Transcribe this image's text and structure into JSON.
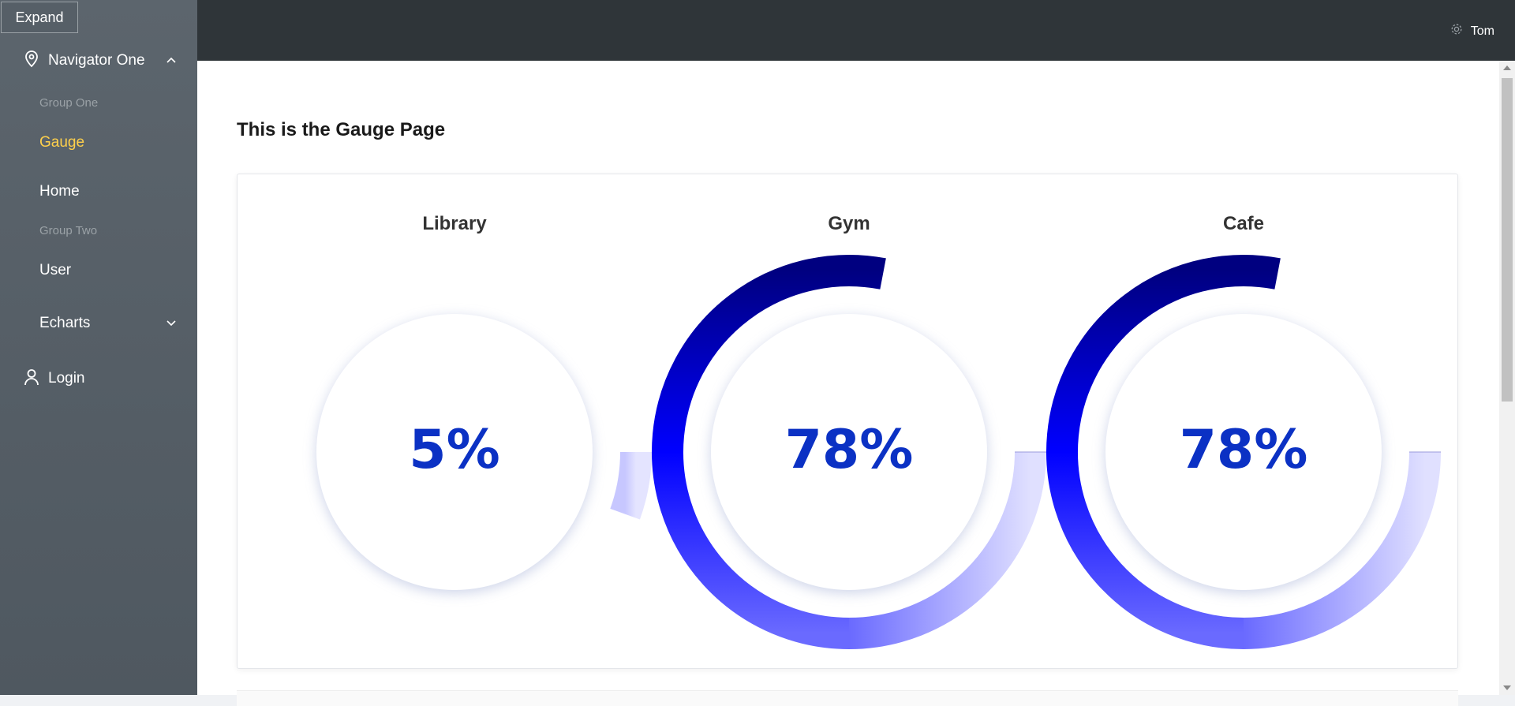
{
  "sidebar": {
    "expand_label": "Expand",
    "navigator_one": "Navigator One",
    "group_one": "Group One",
    "gauge": "Gauge",
    "home": "Home",
    "group_two": "Group Two",
    "user": "User",
    "echarts": "Echarts",
    "login": "Login"
  },
  "header": {
    "user_name": "Tom"
  },
  "main": {
    "page_title": "This is the Gauge Page"
  },
  "colors": {
    "accent": "#ffd04b",
    "value_text": "#0b31c4",
    "gauge_dark": "#000080",
    "gauge_mid": "#0000ff",
    "gauge_light": "#e0e0ff"
  },
  "chart_data": [
    {
      "type": "gauge",
      "title": "Library",
      "value": 5,
      "label": "5%"
    },
    {
      "type": "gauge",
      "title": "Gym",
      "value": 78,
      "label": "78%"
    },
    {
      "type": "gauge",
      "title": "Cafe",
      "value": 78,
      "label": "78%"
    }
  ]
}
